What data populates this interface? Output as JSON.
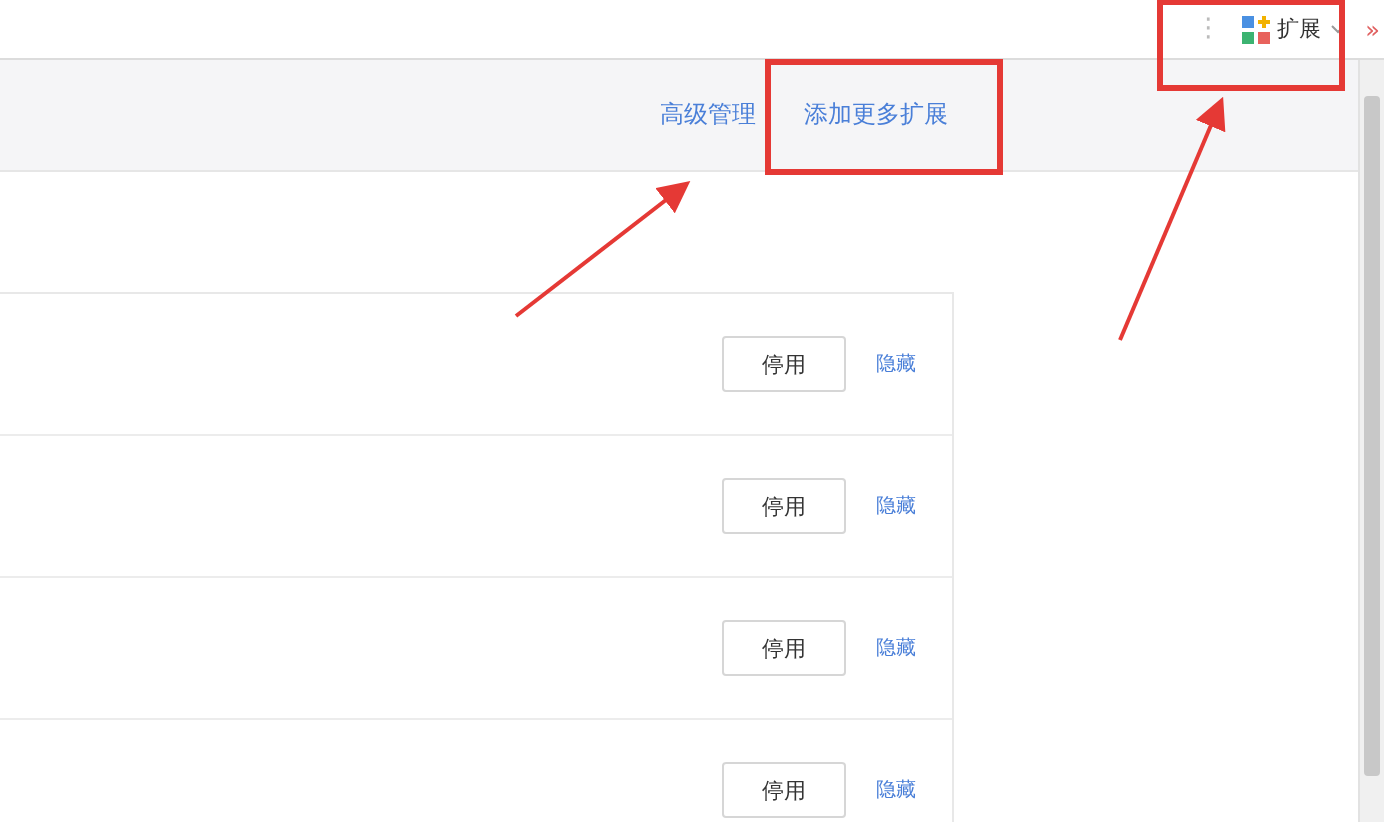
{
  "toolbar": {
    "menu_icon": "⋮",
    "extensions_label": "扩展",
    "overflow": "»"
  },
  "header": {
    "links": [
      "高级管理",
      "添加更多扩展"
    ]
  },
  "extensions": [
    {
      "toggle": "停用",
      "hide": "隐藏"
    },
    {
      "toggle": "停用",
      "hide": "隐藏"
    },
    {
      "toggle": "停用",
      "hide": "隐藏"
    },
    {
      "toggle": "停用",
      "hide": "隐藏"
    }
  ]
}
